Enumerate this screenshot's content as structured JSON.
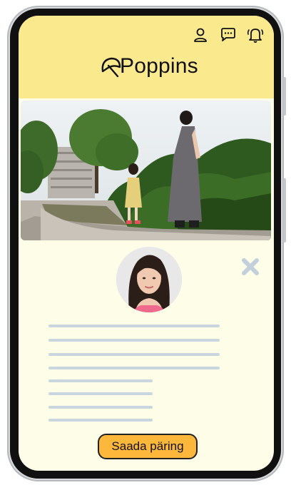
{
  "app": {
    "brand_name": "Poppins"
  },
  "header": {
    "icons": [
      "user-icon",
      "chat-icon",
      "bell-icon"
    ],
    "background": "#fbe98e"
  },
  "profile": {
    "close_icon": "close-icon"
  },
  "actions": {
    "request_label": "Saada päring",
    "request_color": "#fdb83c"
  },
  "colors": {
    "screen_background": "#fdfde8",
    "placeholder_lines": "#c9d5df"
  }
}
